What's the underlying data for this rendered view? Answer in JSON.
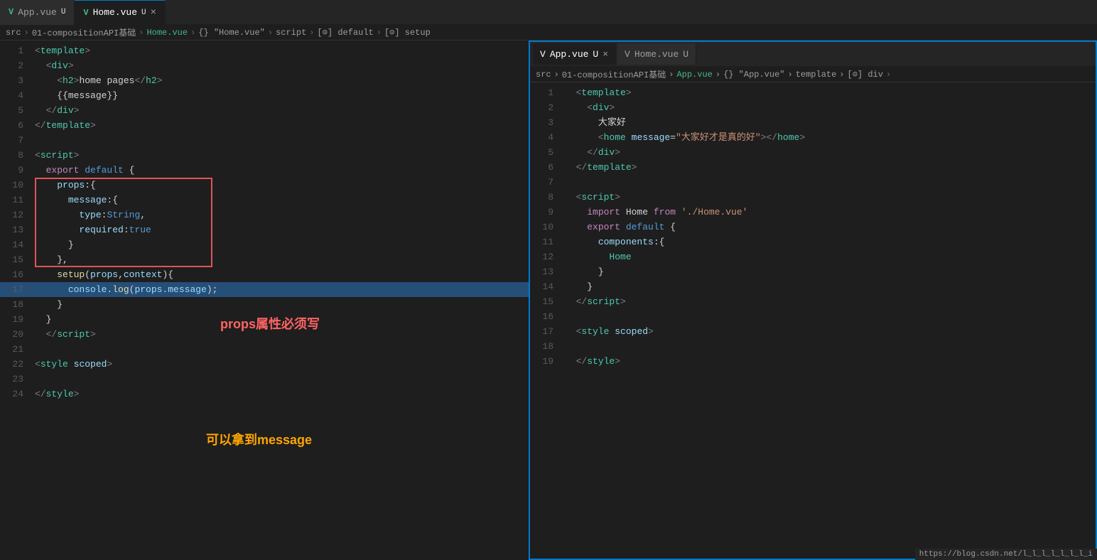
{
  "left_editor": {
    "tabs": [
      {
        "id": "app-vue",
        "label": "App.vue",
        "modified": "U",
        "active": false,
        "closeable": false
      },
      {
        "id": "home-vue",
        "label": "Home.vue",
        "modified": "U",
        "active": true,
        "closeable": true
      }
    ],
    "breadcrumb": [
      "src",
      "01-compositionAPI基础",
      "Home.vue",
      "{} \"Home.vue\"",
      "script",
      "[⊙] default",
      "[⊙] setup"
    ],
    "lines": [
      {
        "num": 1,
        "tokens": [
          {
            "t": "<",
            "c": "kw-tag"
          },
          {
            "t": "template",
            "c": "kw-tagname"
          },
          {
            "t": ">",
            "c": "kw-tag"
          }
        ]
      },
      {
        "num": 2,
        "tokens": [
          {
            "t": "  <",
            "c": "kw-tag"
          },
          {
            "t": "div",
            "c": "kw-tagname"
          },
          {
            "t": ">",
            "c": "kw-tag"
          }
        ]
      },
      {
        "num": 3,
        "tokens": [
          {
            "t": "    <",
            "c": "kw-tag"
          },
          {
            "t": "h2",
            "c": "kw-tagname"
          },
          {
            "t": ">",
            "c": "kw-tag"
          },
          {
            "t": "home pages",
            "c": "kw-text"
          },
          {
            "t": "</",
            "c": "kw-tag"
          },
          {
            "t": "h2",
            "c": "kw-tagname"
          },
          {
            "t": ">",
            "c": "kw-tag"
          }
        ]
      },
      {
        "num": 4,
        "tokens": [
          {
            "t": "    ",
            "c": "kw-text"
          },
          {
            "t": "{{message}}",
            "c": "kw-mustache"
          }
        ]
      },
      {
        "num": 5,
        "tokens": [
          {
            "t": "  </",
            "c": "kw-tag"
          },
          {
            "t": "div",
            "c": "kw-tagname"
          },
          {
            "t": ">",
            "c": "kw-tag"
          }
        ]
      },
      {
        "num": 6,
        "tokens": [
          {
            "t": "</",
            "c": "kw-tag"
          },
          {
            "t": "template",
            "c": "kw-tagname"
          },
          {
            "t": ">",
            "c": "kw-tag"
          }
        ]
      },
      {
        "num": 7,
        "tokens": []
      },
      {
        "num": 8,
        "tokens": [
          {
            "t": "<",
            "c": "kw-tag"
          },
          {
            "t": "script",
            "c": "kw-tagname"
          },
          {
            "t": ">",
            "c": "kw-tag"
          }
        ]
      },
      {
        "num": 9,
        "tokens": [
          {
            "t": "  ",
            "c": "kw-text"
          },
          {
            "t": "export ",
            "c": "kw-export"
          },
          {
            "t": "default",
            "c": "kw-default"
          },
          {
            "t": " {",
            "c": "kw-text"
          }
        ]
      },
      {
        "num": 10,
        "tokens": [
          {
            "t": "    ",
            "c": "kw-text"
          },
          {
            "t": "props",
            "c": "kw-prop"
          },
          {
            "t": ":{",
            "c": "kw-text"
          }
        ],
        "boxStart": true
      },
      {
        "num": 11,
        "tokens": [
          {
            "t": "      ",
            "c": "kw-text"
          },
          {
            "t": "message",
            "c": "kw-prop"
          },
          {
            "t": ":{",
            "c": "kw-text"
          }
        ]
      },
      {
        "num": 12,
        "tokens": [
          {
            "t": "        ",
            "c": "kw-text"
          },
          {
            "t": "type",
            "c": "kw-prop"
          },
          {
            "t": ":",
            "c": "kw-text"
          },
          {
            "t": "String",
            "c": "kw-val"
          },
          {
            "t": ",",
            "c": "kw-text"
          }
        ]
      },
      {
        "num": 13,
        "tokens": [
          {
            "t": "        ",
            "c": "kw-text"
          },
          {
            "t": "required",
            "c": "kw-prop"
          },
          {
            "t": ":",
            "c": "kw-text"
          },
          {
            "t": "true",
            "c": "kw-val"
          }
        ]
      },
      {
        "num": 14,
        "tokens": [
          {
            "t": "      ",
            "c": "kw-text"
          },
          {
            "t": "}",
            "c": "kw-text"
          }
        ],
        "boxEnd": true
      },
      {
        "num": 15,
        "tokens": [
          {
            "t": "    ",
            "c": "kw-text"
          },
          {
            "t": "},",
            "c": "kw-text"
          }
        ]
      },
      {
        "num": 16,
        "tokens": [
          {
            "t": "    ",
            "c": "kw-text"
          },
          {
            "t": "setup",
            "c": "kw-fn"
          },
          {
            "t": "(",
            "c": "kw-text"
          },
          {
            "t": "props",
            "c": "kw-prop"
          },
          {
            "t": ",",
            "c": "kw-text"
          },
          {
            "t": "context",
            "c": "kw-prop"
          },
          {
            "t": "){",
            "c": "kw-text"
          }
        ]
      },
      {
        "num": 17,
        "tokens": [
          {
            "t": "      ",
            "c": "kw-text"
          },
          {
            "t": "console",
            "c": "kw-console"
          },
          {
            "t": ".",
            "c": "kw-text"
          },
          {
            "t": "log",
            "c": "kw-log"
          },
          {
            "t": "(",
            "c": "kw-text"
          },
          {
            "t": "props.message",
            "c": "kw-console"
          },
          {
            "t": ");",
            "c": "kw-text"
          }
        ],
        "selected": true
      },
      {
        "num": 18,
        "tokens": [
          {
            "t": "    ",
            "c": "kw-text"
          },
          {
            "t": "}",
            "c": "kw-text"
          }
        ]
      },
      {
        "num": 19,
        "tokens": [
          {
            "t": "  ",
            "c": "kw-text"
          },
          {
            "t": "}",
            "c": "kw-text"
          }
        ]
      },
      {
        "num": 20,
        "tokens": [
          {
            "t": "  </",
            "c": "kw-tag"
          },
          {
            "t": "script",
            "c": "kw-tagname"
          },
          {
            "t": ">",
            "c": "kw-tag"
          }
        ]
      },
      {
        "num": 21,
        "tokens": []
      },
      {
        "num": 22,
        "tokens": [
          {
            "t": "<",
            "c": "kw-tag"
          },
          {
            "t": "style",
            "c": "kw-tagname"
          },
          {
            "t": " ",
            "c": "kw-text"
          },
          {
            "t": "scoped",
            "c": "kw-scope"
          },
          {
            "t": ">",
            "c": "kw-tag"
          }
        ]
      },
      {
        "num": 23,
        "tokens": []
      },
      {
        "num": 24,
        "tokens": [
          {
            "t": "</",
            "c": "kw-tag"
          },
          {
            "t": "style",
            "c": "kw-tagname"
          },
          {
            "t": ">",
            "c": "kw-tag"
          }
        ]
      }
    ],
    "annotation_props": "props属性必须写",
    "annotation_can_get": "可以拿到message"
  },
  "right_editor": {
    "tabs": [
      {
        "id": "app-vue-r",
        "label": "App.vue",
        "modified": "U",
        "active": true,
        "closeable": true
      },
      {
        "id": "home-vue-r",
        "label": "Home.vue",
        "modified": "U",
        "active": false,
        "closeable": false
      }
    ],
    "breadcrumb": [
      "src",
      "01-compositionAPI基础",
      "App.vue",
      "{} \"App.vue\"",
      "template",
      "[⊙] div"
    ],
    "lines": [
      {
        "num": 1,
        "tokens": [
          {
            "t": "  <",
            "c": "kw-tag"
          },
          {
            "t": "template",
            "c": "kw-tagname"
          },
          {
            "t": ">",
            "c": "kw-tag"
          }
        ]
      },
      {
        "num": 2,
        "tokens": [
          {
            "t": "    <",
            "c": "kw-tag"
          },
          {
            "t": "div",
            "c": "kw-tagname"
          },
          {
            "t": ">",
            "c": "kw-tag"
          }
        ]
      },
      {
        "num": 3,
        "tokens": [
          {
            "t": "      ",
            "c": "kw-text"
          },
          {
            "t": "大家好",
            "c": "kw-chinese-text"
          }
        ]
      },
      {
        "num": 4,
        "tokens": [
          {
            "t": "      <",
            "c": "kw-tag"
          },
          {
            "t": "home",
            "c": "kw-home-comp"
          },
          {
            "t": " ",
            "c": "kw-text"
          },
          {
            "t": "message",
            "c": "kw-attr"
          },
          {
            "t": "=",
            "c": "kw-text"
          },
          {
            "t": "\"大家好才是真的好\"",
            "c": "kw-string"
          },
          {
            "t": ">",
            "c": "kw-tag"
          },
          {
            "t": "</",
            "c": "kw-tag"
          },
          {
            "t": "home",
            "c": "kw-home-comp"
          },
          {
            "t": ">",
            "c": "kw-tag"
          }
        ]
      },
      {
        "num": 5,
        "tokens": [
          {
            "t": "    </",
            "c": "kw-tag"
          },
          {
            "t": "div",
            "c": "kw-tagname"
          },
          {
            "t": ">",
            "c": "kw-tag"
          }
        ]
      },
      {
        "num": 6,
        "tokens": [
          {
            "t": "  </",
            "c": "kw-tag"
          },
          {
            "t": "template",
            "c": "kw-tagname"
          },
          {
            "t": ">",
            "c": "kw-tag"
          }
        ]
      },
      {
        "num": 7,
        "tokens": []
      },
      {
        "num": 8,
        "tokens": [
          {
            "t": "  <",
            "c": "kw-tag"
          },
          {
            "t": "script",
            "c": "kw-tagname"
          },
          {
            "t": ">",
            "c": "kw-tag"
          }
        ]
      },
      {
        "num": 9,
        "tokens": [
          {
            "t": "    ",
            "c": "kw-text"
          },
          {
            "t": "import ",
            "c": "kw-export"
          },
          {
            "t": "Home ",
            "c": "kw-text"
          },
          {
            "t": "from ",
            "c": "kw-from"
          },
          {
            "t": "'./Home.vue'",
            "c": "kw-import-path"
          }
        ]
      },
      {
        "num": 10,
        "tokens": [
          {
            "t": "    ",
            "c": "kw-text"
          },
          {
            "t": "export ",
            "c": "kw-export"
          },
          {
            "t": "default",
            "c": "kw-default"
          },
          {
            "t": " {",
            "c": "kw-text"
          }
        ]
      },
      {
        "num": 11,
        "tokens": [
          {
            "t": "      ",
            "c": "kw-text"
          },
          {
            "t": "components",
            "c": "kw-components"
          },
          {
            "t": ":{",
            "c": "kw-text"
          }
        ]
      },
      {
        "num": 12,
        "tokens": [
          {
            "t": "        ",
            "c": "kw-text"
          },
          {
            "t": "Home",
            "c": "kw-home-comp"
          }
        ]
      },
      {
        "num": 13,
        "tokens": [
          {
            "t": "      ",
            "c": "kw-text"
          },
          {
            "t": "}",
            "c": "kw-text"
          }
        ]
      },
      {
        "num": 14,
        "tokens": [
          {
            "t": "    ",
            "c": "kw-text"
          },
          {
            "t": "}",
            "c": "kw-text"
          }
        ]
      },
      {
        "num": 15,
        "tokens": [
          {
            "t": "  </",
            "c": "kw-tag"
          },
          {
            "t": "script",
            "c": "kw-tagname"
          },
          {
            "t": ">",
            "c": "kw-tag"
          }
        ]
      },
      {
        "num": 16,
        "tokens": []
      },
      {
        "num": 17,
        "tokens": [
          {
            "t": "  <",
            "c": "kw-tag"
          },
          {
            "t": "style",
            "c": "kw-tagname"
          },
          {
            "t": " ",
            "c": "kw-text"
          },
          {
            "t": "scoped",
            "c": "kw-scope"
          },
          {
            "t": ">",
            "c": "kw-tag"
          }
        ]
      },
      {
        "num": 18,
        "tokens": []
      },
      {
        "num": 19,
        "tokens": [
          {
            "t": "  </",
            "c": "kw-tag"
          },
          {
            "t": "style",
            "c": "kw-tagname"
          },
          {
            "t": ">",
            "c": "kw-tag"
          }
        ]
      }
    ]
  },
  "bottom_link": "https://blog.csdn.net/l_l_l_l_l_l_l_i"
}
